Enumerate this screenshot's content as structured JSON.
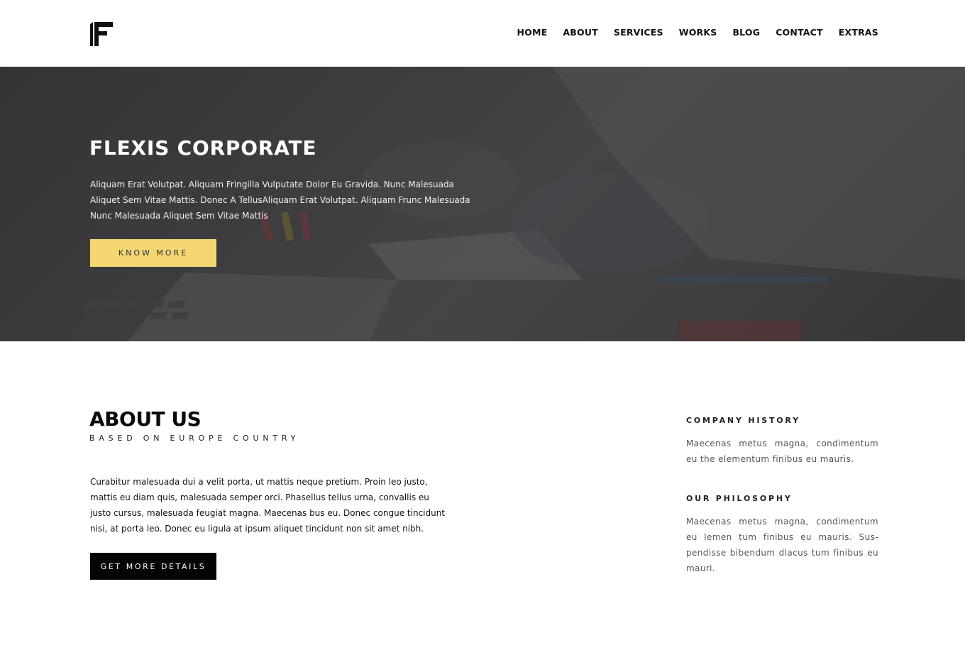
{
  "header": {
    "logo_name": "flexis-logo",
    "nav": [
      "HOME",
      "ABOUT",
      "SERVICES",
      "WORKS",
      "BLOG",
      "CONTACT",
      "EXTRAS"
    ]
  },
  "hero": {
    "title": "FLEXIS CORPORATE",
    "text": "Aliquam Erat Volutpat. Aliquam Fringilla Vulputate Dolor Eu Gravida. Nunc Malesuada Aliquet Sem Vitae Mattis. Donec A TellusAliquam Erat Volutpat. Aliquam Frunc Malesuada Nunc Malesuada Aliquet Sem Vitae Mattis",
    "button": "KNOW MORE",
    "button_color": "#f4d772"
  },
  "about": {
    "title": "ABOUT US",
    "subtitle": "BASED ON EUROPE COUNTRY",
    "body": "Curabitur malesuada dui a velit porta, ut mattis neque pretium. Proin leo justo, mattis eu diam quis, malesuada semper orci. Phasellus tellus urna, convallis eu justo cursus, malesuada feugiat magna. Maecenas bus eu. Donec congue tincidunt nisi, at porta leo. Donec eu ligula at ipsum aliquet tincidunt non sit amet nibh.",
    "button": "GET MORE DETAILS"
  },
  "sidebar": {
    "history_title": "COMPANY HISTORY",
    "history_text": "Maecenas metus magna, condimentum eu the elementum finibus eu mauris.",
    "philosophy_title": "OUR PHILOSOPHY",
    "philosophy_text": "Maecenas metus magna, condimentum eu lemen tum finibus eu mauris. Sus-pendisse bibendum dlacus tum finibus eu mauri."
  }
}
